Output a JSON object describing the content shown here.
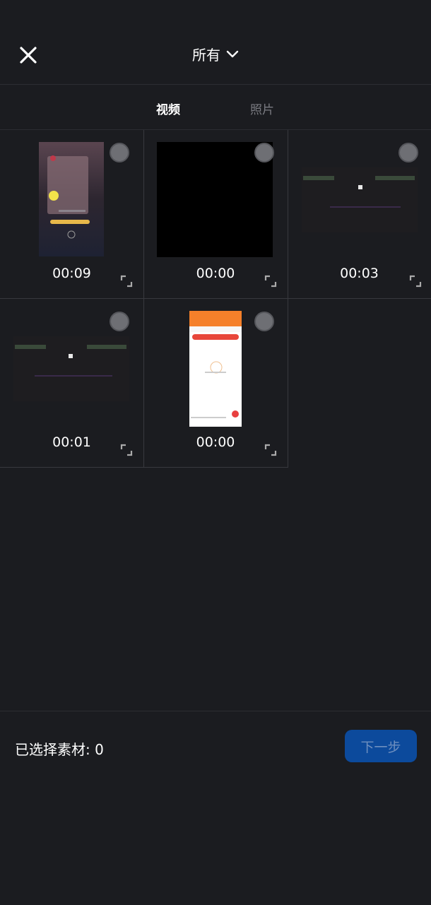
{
  "header": {
    "album_label": "所有"
  },
  "tabs": [
    {
      "label": "视频",
      "active": true
    },
    {
      "label": "照片",
      "active": false
    }
  ],
  "items": [
    {
      "duration": "00:09",
      "thumb": "screen-recording-portrait"
    },
    {
      "duration": "00:00",
      "thumb": "black"
    },
    {
      "duration": "00:03",
      "thumb": "dark-landscape"
    },
    {
      "duration": "00:01",
      "thumb": "dark-landscape"
    },
    {
      "duration": "00:00",
      "thumb": "app-screen-portrait"
    }
  ],
  "footer": {
    "selected_label": "已选择素材: 0",
    "next_label": "下一步"
  },
  "colors": {
    "background": "#1b1c20",
    "next_button": "#0c4a9c",
    "app_orange": "#f5802a"
  }
}
